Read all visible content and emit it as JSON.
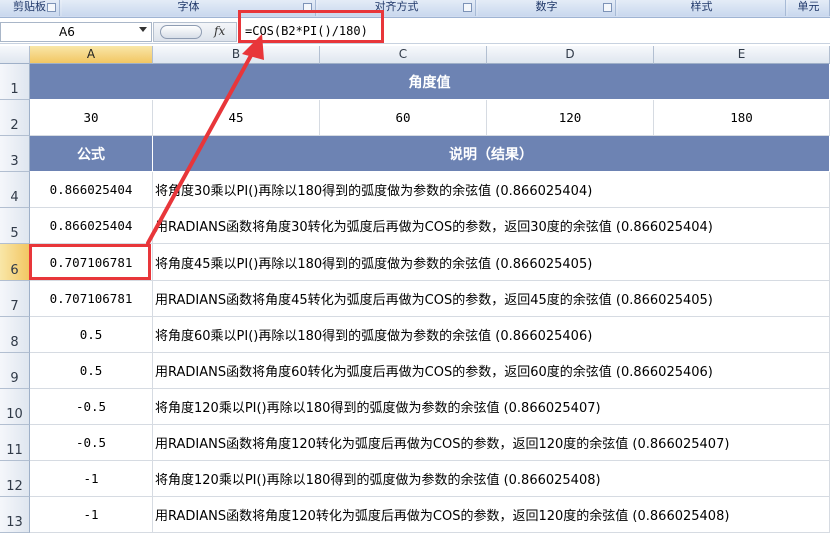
{
  "ribbon": {
    "groups": [
      "剪贴板",
      "字体",
      "对齐方式",
      "数字",
      "样式",
      "单元"
    ]
  },
  "formula_bar": {
    "name_box": "A6",
    "fx_label": "fx",
    "formula": "=COS(B2*PI()/180)"
  },
  "columns": [
    "A",
    "B",
    "C",
    "D",
    "E"
  ],
  "rows": [
    "1",
    "2",
    "3",
    "4",
    "5",
    "6",
    "7",
    "8",
    "9",
    "10",
    "11",
    "12",
    "13"
  ],
  "sheet": {
    "title": "角度值",
    "angles": [
      "30",
      "45",
      "60",
      "120",
      "180"
    ],
    "formula_header": "公式",
    "desc_header": "说明（结果）",
    "data": [
      {
        "value": "0.866025404",
        "desc": "将角度30乘以PI()再除以180得到的弧度做为参数的余弦值 (0.866025404)"
      },
      {
        "value": "0.866025404",
        "desc": "用RADIANS函数将角度30转化为弧度后再做为COS的参数，返回30度的余弦值 (0.866025404)"
      },
      {
        "value": "0.707106781",
        "desc": "将角度45乘以PI()再除以180得到的弧度做为参数的余弦值 (0.866025405)"
      },
      {
        "value": "0.707106781",
        "desc": "用RADIANS函数将角度45转化为弧度后再做为COS的参数，返回45度的余弦值 (0.866025405)"
      },
      {
        "value": "0.5",
        "desc": "将角度60乘以PI()再除以180得到的弧度做为参数的余弦值 (0.866025406)"
      },
      {
        "value": "0.5",
        "desc": "用RADIANS函数将角度60转化为弧度后再做为COS的参数，返回60度的余弦值 (0.866025406)"
      },
      {
        "value": "-0.5",
        "desc": "将角度120乘以PI()再除以180得到的弧度做为参数的余弦值 (0.866025407)"
      },
      {
        "value": "-0.5",
        "desc": "用RADIANS函数将角度120转化为弧度后再做为COS的参数，返回120度的余弦值 (0.866025407)"
      },
      {
        "value": "-1",
        "desc": "将角度120乘以PI()再除以180得到的弧度做为参数的余弦值 (0.866025408)"
      },
      {
        "value": "-1",
        "desc": "用RADIANS函数将角度120转化为弧度后再做为COS的参数，返回120度的余弦值 (0.866025408)"
      }
    ]
  },
  "colors": {
    "header_fill": "#6d83b3",
    "annotation": "#e8363a",
    "selected_header": "#f2c663"
  }
}
